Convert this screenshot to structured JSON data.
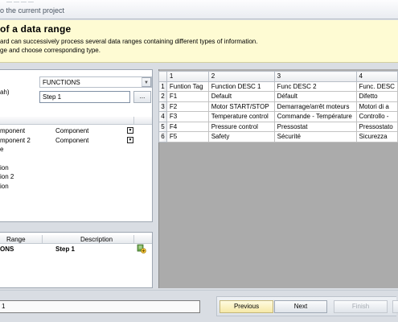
{
  "window": {
    "faint_text": "— — — —",
    "title": "o the current project"
  },
  "header": {
    "title": "of a data range",
    "line1": "ard can successively process several data ranges containing different types of information.",
    "line2": "ge and choose corresponding type."
  },
  "form": {
    "tab_label": "ah)",
    "type_value": "FUNCTIONS",
    "name_value": "Step 1",
    "browse_label": "..."
  },
  "mapping": {
    "rows": [
      {
        "left": "mponent",
        "right": "Component",
        "has_dropdown": true
      },
      {
        "left": "mponent 2",
        "right": "Component",
        "has_dropdown": true
      },
      {
        "left": "e"
      },
      {
        "left": ""
      },
      {
        "left": "ion"
      },
      {
        "left": "ion 2"
      },
      {
        "left": "ion"
      }
    ]
  },
  "ranges": {
    "headers": [
      "Range",
      "Description"
    ],
    "rows": [
      {
        "range": "ONS",
        "description": "Step 1"
      }
    ]
  },
  "grid": {
    "columns": [
      "",
      "1",
      "2",
      "3",
      "4"
    ],
    "rows": [
      [
        "1",
        "Funtion Tag",
        "Function DESC 1",
        "Func DESC 2",
        "Func. DESC"
      ],
      [
        "2",
        "F1",
        "Default",
        "Défault",
        "Difetto"
      ],
      [
        "3",
        "F2",
        "Motor START/STOP",
        "Demarrage/arrêt moteurs",
        "Motori di a"
      ],
      [
        "4",
        "F3",
        "Temperature control",
        "Commande - Température",
        "Controllo -"
      ],
      [
        "5",
        "F4",
        "Pressure control",
        "Pressostat",
        "Pressostato"
      ],
      [
        "6",
        "F5",
        "Safety",
        "Sécurité",
        "Sicurezza"
      ]
    ]
  },
  "footer": {
    "status": "1",
    "previous": "Previous",
    "next": "Next",
    "finish": "Finish"
  }
}
